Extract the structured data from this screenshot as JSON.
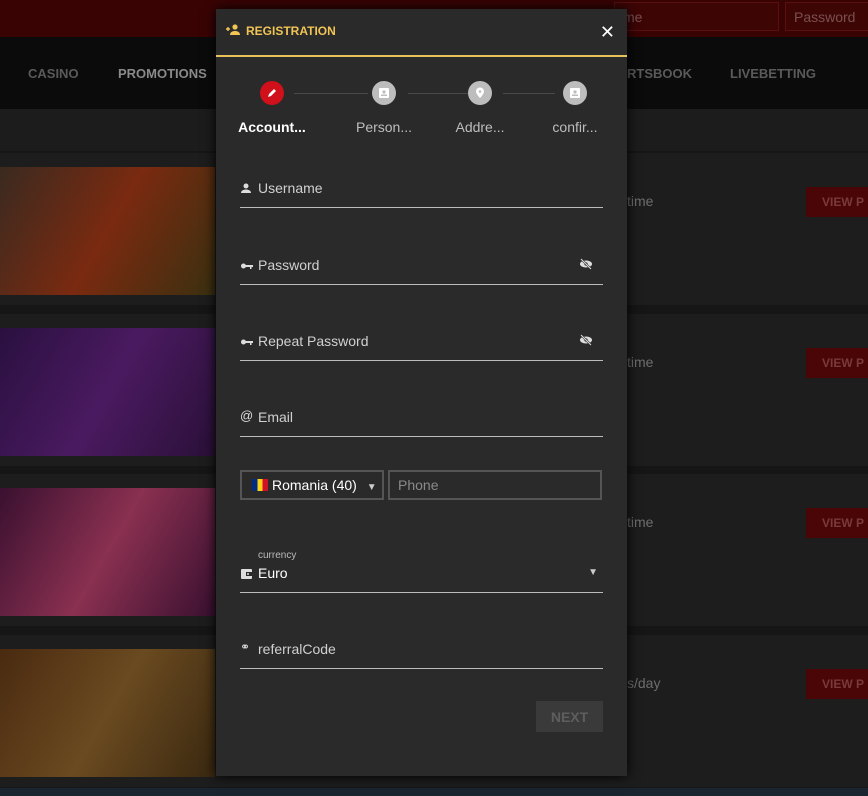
{
  "background": {
    "login": {
      "username_partial": "me",
      "password_placeholder": "Password"
    },
    "nav": [
      "CASINO",
      "PROMOTIONS",
      "RTSBOOK",
      "LIVEBETTING"
    ],
    "cards": [
      {
        "text": "time",
        "button": "VIEW P"
      },
      {
        "text": "time",
        "button": "VIEW P"
      },
      {
        "text": "time",
        "button": "VIEW P"
      },
      {
        "text": "s/day",
        "button": "VIEW P"
      }
    ]
  },
  "modal": {
    "title": "REGISTRATION",
    "title_icon": "person-add-icon",
    "close_icon": "close-icon",
    "accent": "#f0c455",
    "steps": [
      {
        "label": "Account...",
        "icon": "pencil-icon",
        "active": true
      },
      {
        "label": "Person...",
        "icon": "contact-card-icon",
        "active": false
      },
      {
        "label": "Addre...",
        "icon": "location-pin-icon",
        "active": false
      },
      {
        "label": "confir...",
        "icon": "contact-card-icon",
        "active": false
      }
    ],
    "fields": {
      "username": "Username",
      "password": "Password",
      "repeat_password": "Repeat Password",
      "email": "Email",
      "country_code": "Romania (40)",
      "phone_placeholder": "Phone",
      "currency_label": "currency",
      "currency_value": "Euro",
      "referral": "referralCode"
    },
    "next_button": "NEXT"
  }
}
